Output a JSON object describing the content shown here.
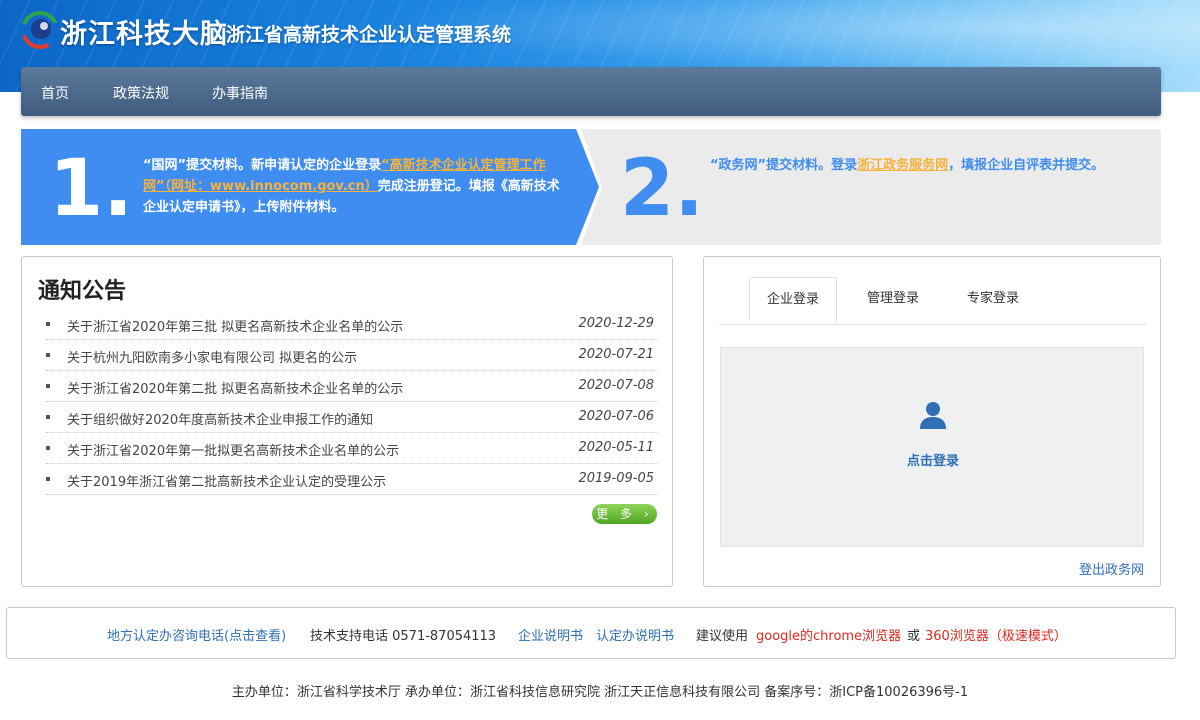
{
  "header": {
    "brand": "浙江科技大脑",
    "system_title": "浙江省高新技术企业认定管理系统"
  },
  "nav": {
    "items": [
      "首页",
      "政策法规",
      "办事指南"
    ]
  },
  "steps": {
    "step1": {
      "number": "1.",
      "text_before": "“国网”提交材料。新申请认定的企业登录",
      "link": "“高新技术企业认定管理工作网”（网址：www.innocom.gov.cn）",
      "text_after": "完成注册登记。填报《高新技术企业认定申请书》，上传附件材料。"
    },
    "step2": {
      "number": "2.",
      "text_before": "“政务网”提交材料。登录",
      "link": "浙江政务服务网",
      "text_after": "，填报企业自评表并提交。"
    }
  },
  "notice": {
    "title": "通知公告",
    "items": [
      {
        "title": "关于浙江省2020年第三批 拟更名高新技术企业名单的公示",
        "date": "2020-12-29"
      },
      {
        "title": "关于杭州九阳欧南多小家电有限公司 拟更名的公示",
        "date": "2020-07-21"
      },
      {
        "title": "关于浙江省2020年第二批 拟更名高新技术企业名单的公示",
        "date": "2020-07-08"
      },
      {
        "title": "关于组织做好2020年度高新技术企业申报工作的通知",
        "date": "2020-07-06"
      },
      {
        "title": "关于浙江省2020年第一批拟更名高新技术企业名单的公示",
        "date": "2020-05-11"
      },
      {
        "title": "关于2019年浙江省第二批高新技术企业认定的受理公示",
        "date": "2019-09-05"
      }
    ],
    "more_label": "更 多 ›"
  },
  "login": {
    "tabs": [
      "企业登录",
      "管理登录",
      "专家登录"
    ],
    "active_tab": "企业登录",
    "click_login": "点击登录",
    "logout": "登出政务网"
  },
  "footer": {
    "consult_phone": "地方认定办咨询电话(点击查看)",
    "tech_support": "技术支持电话 0571-87054113",
    "company_manual": "企业说明书",
    "office_manual": "认定办说明书",
    "browser_prefix": "建议使用",
    "browser_chrome": "google的chrome浏览器",
    "browser_or": "或",
    "browser_360": "360浏览器（极速模式）"
  },
  "copyright": "主办单位：浙江省科学技术厅 承办单位：浙江省科技信息研究院 浙江天正信息科技有限公司 备案序号：浙ICP备10026396号-1",
  "colors": {
    "step_blue": "#3f8df1",
    "link_orange": "#f7b23b",
    "nav_bg": "#4a6789",
    "link_blue": "#2f6fb5",
    "warn_red": "#e0281f",
    "more_green": "#5cb531"
  }
}
